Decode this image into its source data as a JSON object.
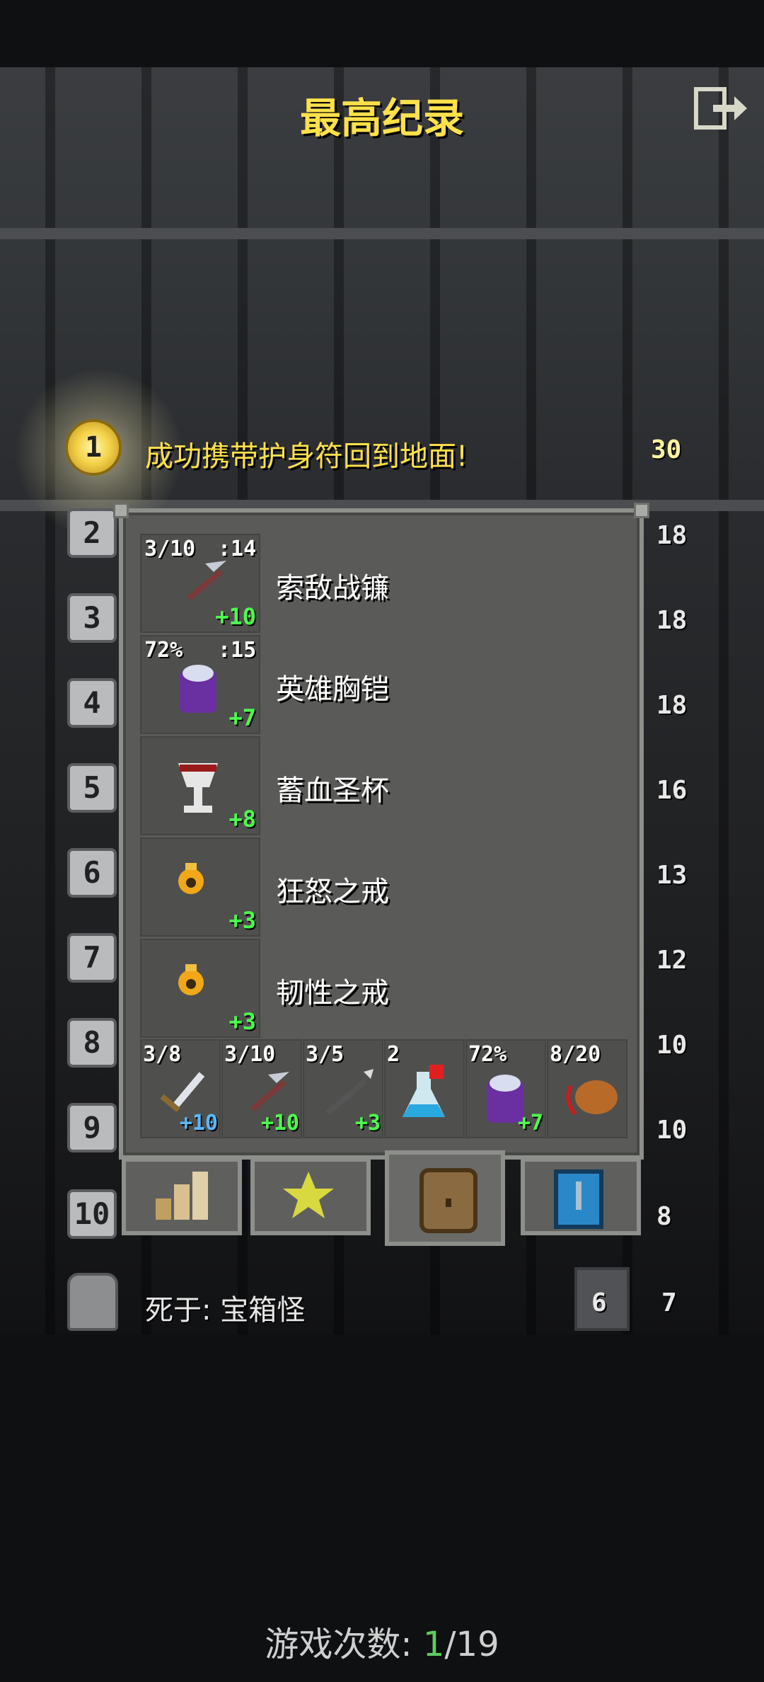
{
  "header": {
    "title": "最高纪录",
    "exit_icon": "exit-icon"
  },
  "top_entry": {
    "rank": "1",
    "text": "成功携带护身符回到地面!",
    "depth": "30"
  },
  "ranks": [
    {
      "rank": "2",
      "score": "18"
    },
    {
      "rank": "3",
      "score": "18"
    },
    {
      "rank": "4",
      "score": "18"
    },
    {
      "rank": "5",
      "score": "16"
    },
    {
      "rank": "6",
      "score": "13"
    },
    {
      "rank": "7",
      "score": "12"
    },
    {
      "rank": "8",
      "score": "10"
    },
    {
      "rank": "9",
      "score": "10"
    },
    {
      "rank": "10",
      "score": "8"
    }
  ],
  "equipment": [
    {
      "name": "索敌战镰",
      "top_left": "3/10",
      "top_right": ":14",
      "bonus": "+10",
      "icon": "scythe-icon"
    },
    {
      "name": "英雄胸铠",
      "top_left": "72%",
      "top_right": ":15",
      "bonus": "+7",
      "icon": "armor-icon"
    },
    {
      "name": "蓄血圣杯",
      "top_left": "",
      "top_right": "",
      "bonus": "+8",
      "icon": "chalice-icon"
    },
    {
      "name": "狂怒之戒",
      "top_left": "",
      "top_right": "",
      "bonus": "+3",
      "icon": "ring-icon"
    },
    {
      "name": "韧性之戒",
      "top_left": "",
      "top_right": "",
      "bonus": "+3",
      "icon": "ring-icon"
    }
  ],
  "quickslots": [
    {
      "top": "3/8",
      "bonus": "+10",
      "bonus_color": "blue",
      "icon": "sword-icon"
    },
    {
      "top": "3/10",
      "bonus": "+10",
      "bonus_color": "green",
      "icon": "scythe-icon"
    },
    {
      "top": "3/5",
      "bonus": "+3",
      "bonus_color": "green",
      "icon": "spear-icon"
    },
    {
      "top": "2",
      "bonus": "",
      "bonus_color": "green",
      "icon": "potion-icon"
    },
    {
      "top": "72%",
      "bonus": "+7",
      "bonus_color": "green",
      "icon": "armor-icon"
    },
    {
      "top": "8/20",
      "bonus": "",
      "bonus_color": "green",
      "icon": "horn-icon"
    }
  ],
  "tabs": [
    {
      "icon": "stats-icon",
      "active": false
    },
    {
      "icon": "badges-icon",
      "active": false
    },
    {
      "icon": "inventory-icon",
      "active": true
    },
    {
      "icon": "journal-icon",
      "active": false
    }
  ],
  "last_entry": {
    "death_text": "死于: 宝箱怪",
    "depth": "6",
    "level": "7"
  },
  "footer": {
    "label": "游戏次数: ",
    "current": "1",
    "total": "/19"
  },
  "colors": {
    "title": "#ffe14a",
    "bonus_green": "#4cff4c",
    "bonus_blue": "#58b8ff",
    "panel": "#5a5b58"
  }
}
